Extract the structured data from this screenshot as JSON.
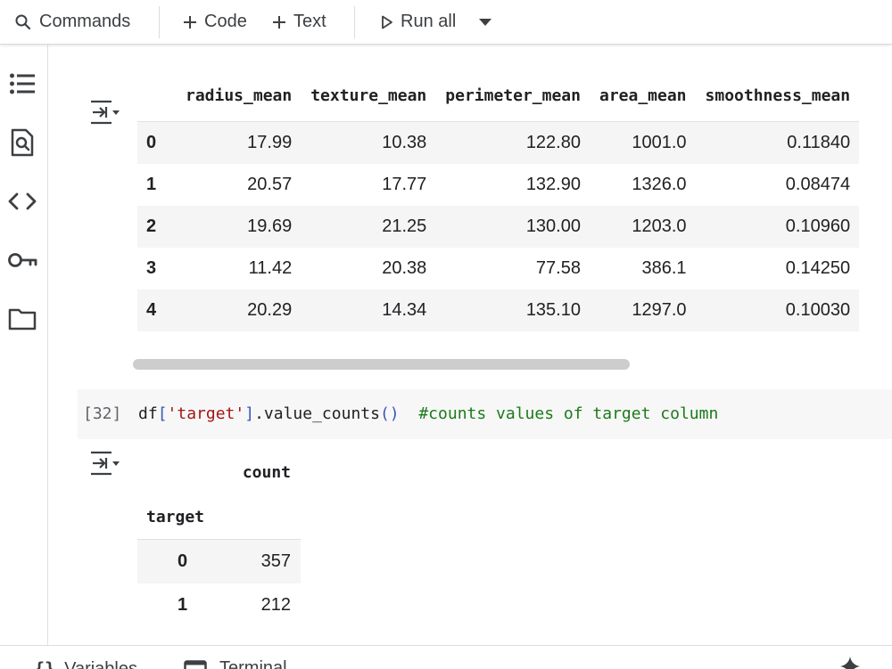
{
  "toolbar": {
    "commands_label": "Commands",
    "code_label": "Code",
    "text_label": "Text",
    "run_all_label": "Run all"
  },
  "rail": {
    "icons": [
      "table-of-contents-icon",
      "find-icon",
      "code-snippets-icon",
      "secrets-key-icon",
      "folder-icon"
    ]
  },
  "dataframe": {
    "columns": [
      "radius_mean",
      "texture_mean",
      "perimeter_mean",
      "area_mean",
      "smoothness_mean"
    ],
    "rows": [
      {
        "index": "0",
        "values": [
          "17.99",
          "10.38",
          "122.80",
          "1001.0",
          "0.11840"
        ]
      },
      {
        "index": "1",
        "values": [
          "20.57",
          "17.77",
          "132.90",
          "1326.0",
          "0.08474"
        ]
      },
      {
        "index": "2",
        "values": [
          "19.69",
          "21.25",
          "130.00",
          "1203.0",
          "0.10960"
        ]
      },
      {
        "index": "3",
        "values": [
          "11.42",
          "20.38",
          "77.58",
          "386.1",
          "0.14250"
        ]
      },
      {
        "index": "4",
        "values": [
          "20.29",
          "14.34",
          "135.10",
          "1297.0",
          "0.10030"
        ]
      }
    ]
  },
  "cell": {
    "exec_count": "[32]",
    "code_prefix": "df",
    "code_bracket_open": "[",
    "code_string": "'target'",
    "code_bracket_close": "]",
    "code_method": ".value_counts",
    "code_parens": "()",
    "code_comment": "#counts values of target column"
  },
  "value_counts": {
    "column_header": "count",
    "index_name": "target",
    "rows": [
      {
        "index": "0",
        "count": "357"
      },
      {
        "index": "1",
        "count": "212"
      }
    ]
  },
  "statusbar": {
    "variables_label": "Variables",
    "terminal_label": "Terminal"
  }
}
